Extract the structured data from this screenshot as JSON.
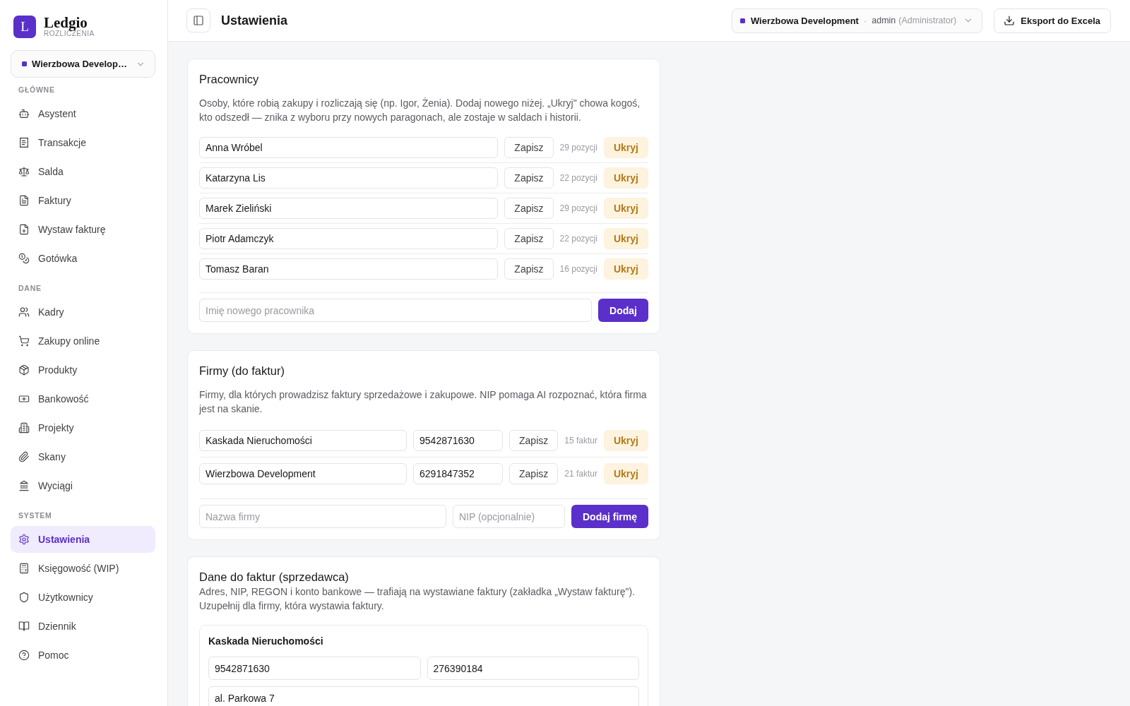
{
  "sidebar": {
    "brand": {
      "logo_letter": "L",
      "name": "Ledgio",
      "tagline": "ROZLICZENIA"
    },
    "company_select": {
      "value": "Wierzbowa Develop…"
    },
    "sections": [
      {
        "label": "GŁÓWNE",
        "items": [
          {
            "label": "Asystent",
            "selected": false
          },
          {
            "label": "Transakcje",
            "selected": false
          },
          {
            "label": "Salda",
            "selected": false
          },
          {
            "label": "Faktury",
            "selected": false
          },
          {
            "label": "Wystaw fakturę",
            "selected": false
          },
          {
            "label": "Gotówka",
            "selected": false
          }
        ]
      },
      {
        "label": "DANE",
        "items": [
          {
            "label": "Kadry",
            "selected": false
          },
          {
            "label": "Zakupy online",
            "selected": false
          },
          {
            "label": "Produkty",
            "selected": false
          },
          {
            "label": "Bankowość",
            "selected": false
          },
          {
            "label": "Projekty",
            "selected": false
          },
          {
            "label": "Skany",
            "selected": false
          },
          {
            "label": "Wyciągi",
            "selected": false
          }
        ]
      },
      {
        "label": "SYSTEM",
        "items": [
          {
            "label": "Ustawienia",
            "selected": true
          },
          {
            "label": "Księgowość (WIP)",
            "selected": false
          },
          {
            "label": "Użytkownicy",
            "selected": false
          },
          {
            "label": "Dziennik",
            "selected": false
          },
          {
            "label": "Pomoc",
            "selected": false
          }
        ]
      }
    ]
  },
  "header": {
    "title": "Ustawienia",
    "company": "Wierzbowa Development",
    "separator": "·",
    "user": "admin",
    "role": "(Administrator)",
    "export_button": "Eksport do Excela"
  },
  "employees": {
    "title": "Pracownicy",
    "description": "Osoby, które robią zakupy i rozliczają się (np. Igor, Żenia). Dodaj nowego niżej. „Ukryj\" chowa kogoś, kto odszedł — znika z wyboru przy nowych paragonach, ale zostaje w saldach i historii.",
    "rows": [
      {
        "name": "Anna Wróbel",
        "save": "Zapisz",
        "count": "29 pozycji",
        "hide": "Ukryj"
      },
      {
        "name": "Katarzyna Lis",
        "save": "Zapisz",
        "count": "22 pozycji",
        "hide": "Ukryj"
      },
      {
        "name": "Marek Zieliński",
        "save": "Zapisz",
        "count": "29 pozycji",
        "hide": "Ukryj"
      },
      {
        "name": "Piotr Adamczyk",
        "save": "Zapisz",
        "count": "22 pozycji",
        "hide": "Ukryj"
      },
      {
        "name": "Tomasz Baran",
        "save": "Zapisz",
        "count": "16 pozycji",
        "hide": "Ukryj"
      }
    ],
    "new_entry": {
      "placeholder": "Imię nowego pracownika",
      "button": "Dodaj"
    }
  },
  "companies": {
    "title": "Firmy (do faktur)",
    "description": "Firmy, dla których prowadzisz faktury sprzedażowe i zakupowe. NIP pomaga AI rozpoznać, która firma jest na skanie.",
    "rows": [
      {
        "name": "Kaskada Nieruchomości",
        "nip": "9542871630",
        "save": "Zapisz",
        "count": "15 faktur",
        "hide": "Ukryj"
      },
      {
        "name": "Wierzbowa Development",
        "nip": "6291847352",
        "save": "Zapisz",
        "count": "21 faktur",
        "hide": "Ukryj"
      }
    ],
    "new_entry": {
      "name_placeholder": "Nazwa firmy",
      "nip_placeholder": "NIP (opcjonalnie)",
      "button": "Dodaj firmę"
    }
  },
  "seller": {
    "title": "Dane do faktur (sprzedawca)",
    "description": "Adres, NIP, REGON i konto bankowe — trafiają na wystawiane faktury (zakładka „Wystaw fakturę\"). Uzupełnij dla firmy, która wystawia faktury.",
    "companies": [
      {
        "name": "Kaskada Nieruchomości",
        "nip": "9542871630",
        "regon": "276390184",
        "address": "al. Parkowa 7"
      }
    ]
  }
}
